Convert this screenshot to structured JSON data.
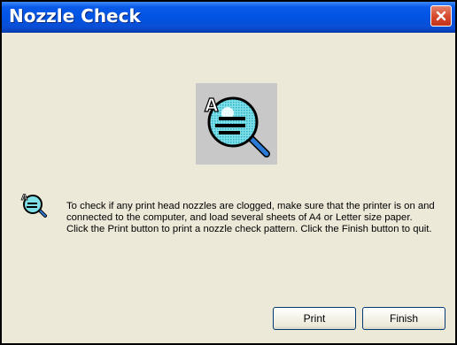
{
  "window": {
    "title": "Nozzle Check"
  },
  "icons": {
    "close": "close-icon",
    "illustration": "nozzle-check-magnifier-icon",
    "message": "nozzle-check-small-icon"
  },
  "content": {
    "message": "To check if any print head nozzles are clogged, make sure that the printer is on and connected to the computer, and load several sheets of A4 or Letter size paper. Click the Print button to print a nozzle check pattern. Click the Finish button to quit."
  },
  "buttons": {
    "print": "Print",
    "finish": "Finish"
  },
  "colors": {
    "titlebar": "#0054e3",
    "close_button": "#d6492c",
    "dialog_background": "#ece9d8",
    "button_border": "#003c74"
  }
}
